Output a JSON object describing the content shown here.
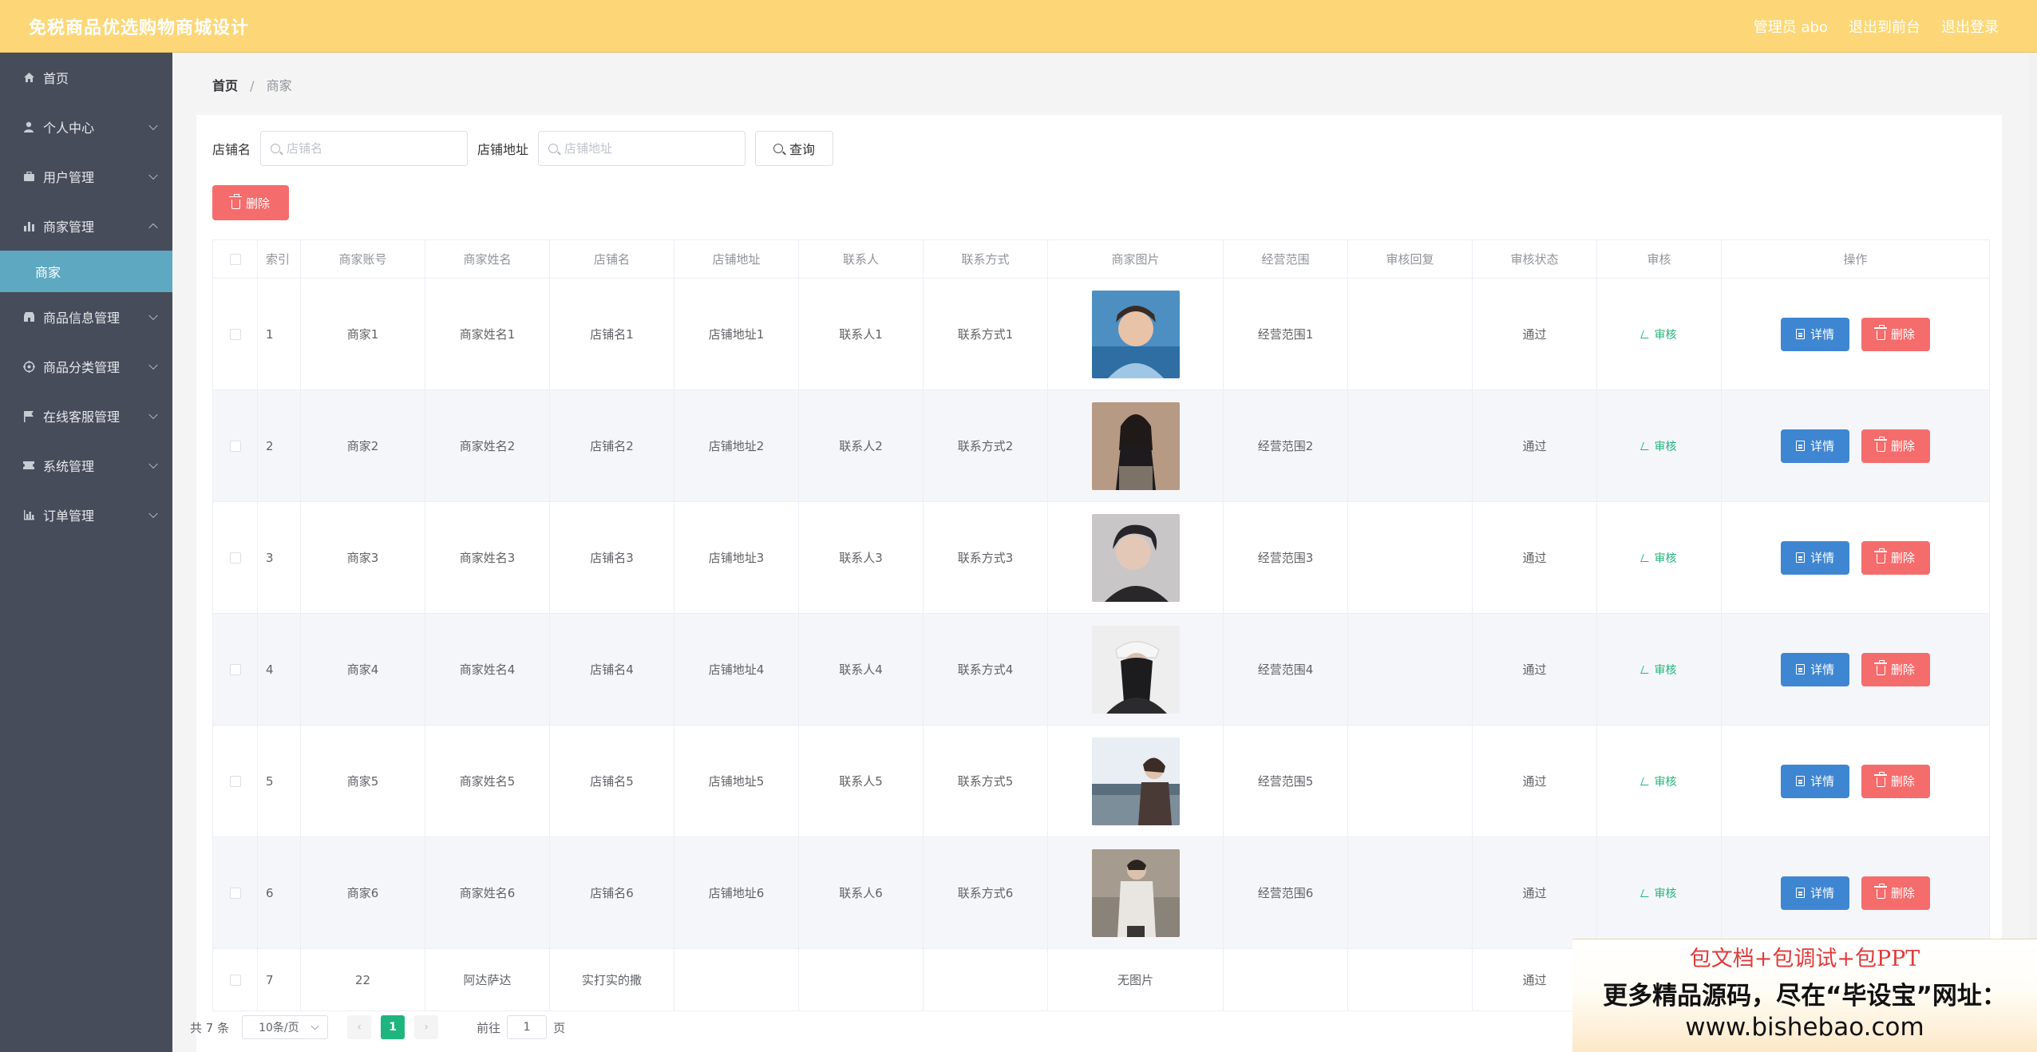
{
  "app": {
    "title": "免税商品优选购物商城设计",
    "admin_label": "管理员 abo",
    "exit_frontend": "退出到前台",
    "logout": "退出登录"
  },
  "sidebar": {
    "items": [
      {
        "label": "首页",
        "icon": "home-icon"
      },
      {
        "label": "个人中心",
        "icon": "user-icon"
      },
      {
        "label": "用户管理",
        "icon": "briefcase-icon"
      },
      {
        "label": "商家管理",
        "icon": "bar-chart-icon",
        "expanded": true
      },
      {
        "label": "商家",
        "sub": true,
        "active": true
      },
      {
        "label": "商品信息管理",
        "icon": "shop-icon"
      },
      {
        "label": "商品分类管理",
        "icon": "target-icon"
      },
      {
        "label": "在线客服管理",
        "icon": "flag-icon"
      },
      {
        "label": "系统管理",
        "icon": "ticket-icon"
      },
      {
        "label": "订单管理",
        "icon": "chart-icon"
      }
    ]
  },
  "breadcrumb": {
    "home": "首页",
    "sep": "/",
    "current": "商家"
  },
  "search": {
    "shop_label": "店铺名",
    "shop_placeholder": "店铺名",
    "addr_label": "店铺地址",
    "addr_placeholder": "店铺地址",
    "query_label": "查询"
  },
  "toolbar": {
    "delete_label": "删除"
  },
  "table": {
    "headers": [
      "",
      "索引",
      "商家账号",
      "商家姓名",
      "店铺名",
      "店铺地址",
      "联系人",
      "联系方式",
      "商家图片",
      "经营范围",
      "审核回复",
      "审核状态",
      "审核",
      "操作"
    ],
    "rows": [
      {
        "idx": "1",
        "account": "商家1",
        "name": "商家姓名1",
        "shop": "店铺名1",
        "addr": "店铺地址1",
        "contact": "联系人1",
        "phone": "联系方式1",
        "scope": "经营范围1",
        "reply": "",
        "status": "通过"
      },
      {
        "idx": "2",
        "account": "商家2",
        "name": "商家姓名2",
        "shop": "店铺名2",
        "addr": "店铺地址2",
        "contact": "联系人2",
        "phone": "联系方式2",
        "scope": "经营范围2",
        "reply": "",
        "status": "通过"
      },
      {
        "idx": "3",
        "account": "商家3",
        "name": "商家姓名3",
        "shop": "店铺名3",
        "addr": "店铺地址3",
        "contact": "联系人3",
        "phone": "联系方式3",
        "scope": "经营范围3",
        "reply": "",
        "status": "通过"
      },
      {
        "idx": "4",
        "account": "商家4",
        "name": "商家姓名4",
        "shop": "店铺名4",
        "addr": "店铺地址4",
        "contact": "联系人4",
        "phone": "联系方式4",
        "scope": "经营范围4",
        "reply": "",
        "status": "通过"
      },
      {
        "idx": "5",
        "account": "商家5",
        "name": "商家姓名5",
        "shop": "店铺名5",
        "addr": "店铺地址5",
        "contact": "联系人5",
        "phone": "联系方式5",
        "scope": "经营范围5",
        "reply": "",
        "status": "通过"
      },
      {
        "idx": "6",
        "account": "商家6",
        "name": "商家姓名6",
        "shop": "店铺名6",
        "addr": "店铺地址6",
        "contact": "联系人6",
        "phone": "联系方式6",
        "scope": "经营范围6",
        "reply": "",
        "status": "通过"
      },
      {
        "idx": "7",
        "account": "22",
        "name": "阿达萨达",
        "shop": "实打实的撒",
        "addr": "",
        "contact": "",
        "phone": "",
        "no_image": "无图片",
        "scope": "",
        "reply": "",
        "status": "通过"
      }
    ],
    "audit_label": "审核",
    "detail_label": "详情",
    "delete_label": "删除"
  },
  "pagination": {
    "total": "共 7 条",
    "page_size": "10条/页",
    "prev": "‹",
    "current": "1",
    "next": "›",
    "goto_prefix": "前往",
    "goto_value": "1",
    "goto_suffix": "页"
  },
  "promo": {
    "line1": "包文档+包调试+包PPT",
    "line2": "更多精品源码，尽在“毕设宝”网址：",
    "line3": "www.bishebao.com"
  },
  "colors": {
    "topbar": "#fdd777",
    "sidebar": "#474c5b",
    "sidebar_active": "#5ea9c1",
    "detail_button": "#3e86d2",
    "delete_button": "#f56c6c",
    "audit_link": "#22b57a",
    "page_active": "#1fb57e"
  }
}
